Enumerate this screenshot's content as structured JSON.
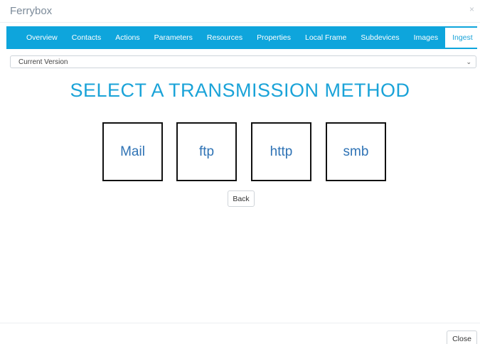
{
  "modal": {
    "title": "Ferrybox",
    "close_icon": "×"
  },
  "tabs": [
    {
      "label": "Overview"
    },
    {
      "label": "Contacts"
    },
    {
      "label": "Actions"
    },
    {
      "label": "Parameters"
    },
    {
      "label": "Resources"
    },
    {
      "label": "Properties"
    },
    {
      "label": "Local Frame"
    },
    {
      "label": "Subdevices"
    },
    {
      "label": "Images"
    },
    {
      "label": "Ingest",
      "active": true
    }
  ],
  "version_select": {
    "selected": "Current Version",
    "chevron_icon": "⌄"
  },
  "heading": "SELECT A TRANSMISSION METHOD",
  "methods": [
    {
      "label": "Mail"
    },
    {
      "label": "ftp"
    },
    {
      "label": "http"
    },
    {
      "label": "smb"
    }
  ],
  "back_label": "Back",
  "close_label": "Close",
  "colors": {
    "accent": "#0ea5dc",
    "heading": "#1aa3d8",
    "method_text": "#2f73b5"
  }
}
